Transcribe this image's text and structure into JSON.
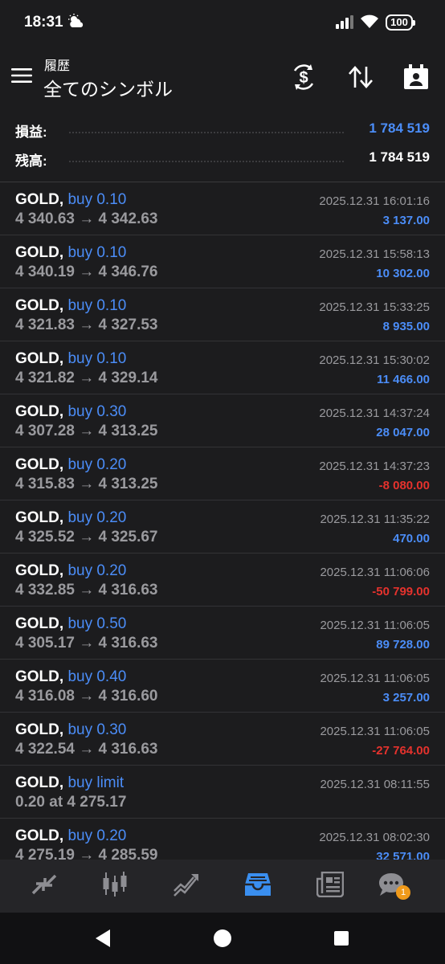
{
  "status_bar": {
    "time": "18:31",
    "battery": "100"
  },
  "header": {
    "subtitle": "履歴",
    "title": "全てのシンボル"
  },
  "summary": {
    "profit_label": "損益:",
    "profit_value": "1 784 519",
    "balance_label": "残高:",
    "balance_value": "1 784 519"
  },
  "colors": {
    "positive": "#4b8df8",
    "negative": "#e5322d",
    "side": "#4b8df8",
    "accent": "#3a8ff0",
    "badge": "#f09a1a"
  },
  "trades": [
    {
      "symbol": "GOLD,",
      "side": "buy 0.10",
      "prices": "4 340.63 → 4 342.63",
      "time": "2025.12.31 16:01:16",
      "pl": "3 137.00",
      "pl_sign": "pos"
    },
    {
      "symbol": "GOLD,",
      "side": "buy 0.10",
      "prices": "4 340.19 → 4 346.76",
      "time": "2025.12.31 15:58:13",
      "pl": "10 302.00",
      "pl_sign": "pos"
    },
    {
      "symbol": "GOLD,",
      "side": "buy 0.10",
      "prices": "4 321.83 → 4 327.53",
      "time": "2025.12.31 15:33:25",
      "pl": "8 935.00",
      "pl_sign": "pos"
    },
    {
      "symbol": "GOLD,",
      "side": "buy 0.10",
      "prices": "4 321.82 → 4 329.14",
      "time": "2025.12.31 15:30:02",
      "pl": "11 466.00",
      "pl_sign": "pos"
    },
    {
      "symbol": "GOLD,",
      "side": "buy 0.30",
      "prices": "4 307.28 → 4 313.25",
      "time": "2025.12.31 14:37:24",
      "pl": "28 047.00",
      "pl_sign": "pos"
    },
    {
      "symbol": "GOLD,",
      "side": "buy 0.20",
      "prices": "4 315.83 → 4 313.25",
      "time": "2025.12.31 14:37:23",
      "pl": "-8 080.00",
      "pl_sign": "neg"
    },
    {
      "symbol": "GOLD,",
      "side": "buy 0.20",
      "prices": "4 325.52 → 4 325.67",
      "time": "2025.12.31 11:35:22",
      "pl": "470.00",
      "pl_sign": "pos"
    },
    {
      "symbol": "GOLD,",
      "side": "buy 0.20",
      "prices": "4 332.85 → 4 316.63",
      "time": "2025.12.31 11:06:06",
      "pl": "-50 799.00",
      "pl_sign": "neg"
    },
    {
      "symbol": "GOLD,",
      "side": "buy 0.50",
      "prices": "4 305.17 → 4 316.63",
      "time": "2025.12.31 11:06:05",
      "pl": "89 728.00",
      "pl_sign": "pos"
    },
    {
      "symbol": "GOLD,",
      "side": "buy 0.40",
      "prices": "4 316.08 → 4 316.60",
      "time": "2025.12.31 11:06:05",
      "pl": "3 257.00",
      "pl_sign": "pos"
    },
    {
      "symbol": "GOLD,",
      "side": "buy 0.30",
      "prices": "4 322.54 → 4 316.63",
      "time": "2025.12.31 11:06:05",
      "pl": "-27 764.00",
      "pl_sign": "neg"
    },
    {
      "symbol": "GOLD,",
      "side": "buy limit",
      "prices": "0.20 at 4 275.17",
      "time": "2025.12.31 08:11:55",
      "pl": "",
      "pl_sign": "none"
    },
    {
      "symbol": "GOLD,",
      "side": "buy 0.20",
      "prices": "4 275.19 → 4 285.59",
      "time": "2025.12.31 08:02:30",
      "pl": "32 571.00",
      "pl_sign": "pos"
    }
  ],
  "tabs": [
    {
      "icon": "quotes-icon",
      "active": false
    },
    {
      "icon": "chart-icon",
      "active": false
    },
    {
      "icon": "trade-icon",
      "active": false
    },
    {
      "icon": "history-icon",
      "active": true
    },
    {
      "icon": "news-icon",
      "active": false
    },
    {
      "icon": "chat-icon",
      "active": false,
      "badge": "1"
    }
  ],
  "nav": [
    "back-icon",
    "home-icon",
    "recents-icon"
  ]
}
